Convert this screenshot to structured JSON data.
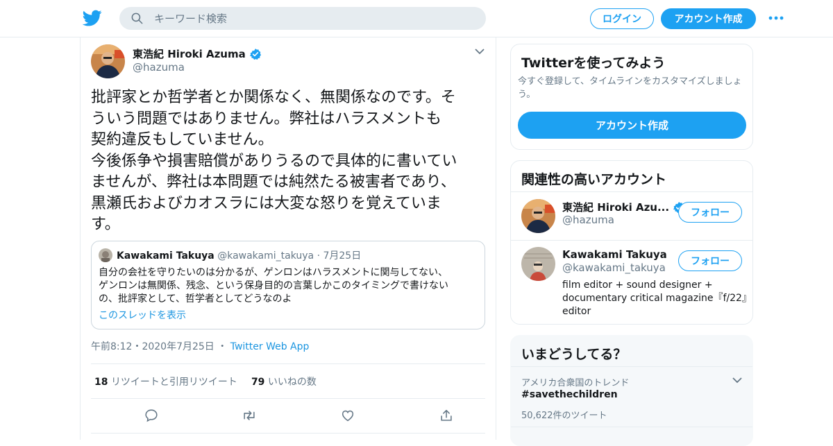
{
  "header": {
    "search_placeholder": "キーワード検索",
    "login_label": "ログイン",
    "signup_label": "アカウント作成"
  },
  "tweet": {
    "author_name": "東浩紀 Hiroki Azuma",
    "author_handle": "@hazuma",
    "text_lines": [
      "批評家とか哲学者とか関係なく、無関係なのです。そ",
      "ういう問題ではありません。弊社はハラスメントも",
      "契約違反もしていません。",
      "今後係争や損害賠償がありうるので具体的に書いてい",
      "ませんが、弊社は本問題では純然たる被害者であり、",
      "黒瀬氏およびカオスラには大変な怒りを覚えていま",
      "す。"
    ],
    "quote": {
      "name": "Kawakami Takuya",
      "handle": "@kawakami_takuya",
      "date": "7月25日",
      "text_lines": [
        "自分の会社を守りたいのは分かるが、ゲンロンはハラスメントに関与してない、",
        "ゲンロンは無関係、残念、という保身目的の言葉しかこのタイミングで書けない",
        "の、批評家として、哲学者としてどうなのよ"
      ],
      "thread_link": "このスレッドを表示"
    },
    "timestamp": "午前8:12・2020年7月25日",
    "source": "Twitter Web App",
    "retweet_count": "18",
    "retweet_label": "リツイートと引用リツイート",
    "like_count": "79",
    "like_label": "いいねの数"
  },
  "sidebar": {
    "signup_card": {
      "title": "Twitterを使ってみよう",
      "description": "今すぐ登録して、タイムラインをカスタマイズしましょう。",
      "button_label": "アカウント作成"
    },
    "related": {
      "title": "関連性の高いアカウント",
      "accounts": [
        {
          "name": "東浩紀 Hiroki Azu...",
          "handle": "@hazuma",
          "follow_label": "フォロー",
          "bio": ""
        },
        {
          "name": "Kawakami Takuya",
          "handle": "@kawakami_takuya",
          "follow_label": "フォロー",
          "bio": "film editor + sound designer + documentary critical magazine『f/22』editor"
        }
      ]
    },
    "trends": {
      "title": "いまどうしてる？",
      "context": "アメリカ合衆国のトレンド",
      "name": "#savethechildren",
      "count": "50,622件のツイート"
    }
  },
  "colors": {
    "brand": "#1da1f2",
    "link": "#1b95e0",
    "muted": "#657786",
    "border": "#e6ecf0"
  }
}
